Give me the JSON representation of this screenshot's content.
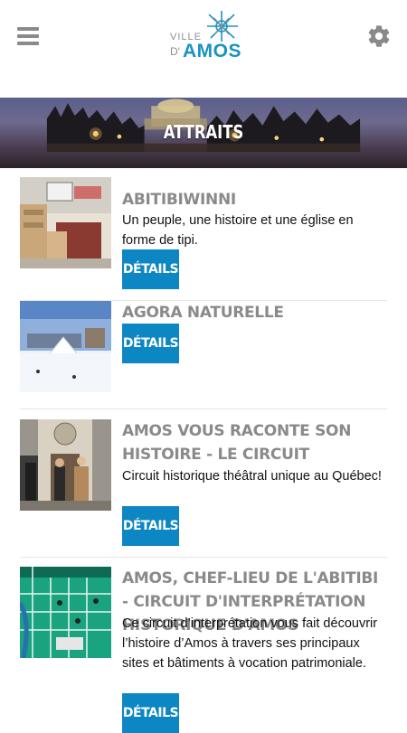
{
  "header": {
    "logo_ville": "VILLE",
    "logo_d": "D'",
    "logo_amos": "AMOS",
    "menu_icon": "hamburger-menu-icon",
    "settings_icon": "gear-icon",
    "logo_color": "#1a93c3"
  },
  "banner": {
    "title": "ATTRAITS"
  },
  "accent_color": "#0d86c4",
  "items": [
    {
      "title": "ABITIBIWINNI",
      "description": "Un peuple, une histoire et une église en forme de tipi.",
      "button": "DÉTAILS"
    },
    {
      "title": "AGORA NATURELLE",
      "description": "",
      "button": "DÉTAILS"
    },
    {
      "title": "AMOS VOUS RACONTE SON HISTOIRE - LE CIRCUIT",
      "description": "Circuit historique théâtral unique au Québec!",
      "button": "DÉTAILS"
    },
    {
      "title": "AMOS, CHEF-LIEU DE L'ABITIBI - CIRCUIT D'INTERPRÉTATION HISTORIQUE D'AMOS",
      "description": "Ce circuit d’interprétation vous fait découvrir l’histoire d’Amos à travers ses principaux sites et bâtiments à vocation patrimoniale.",
      "button": "DÉTAILS"
    }
  ]
}
